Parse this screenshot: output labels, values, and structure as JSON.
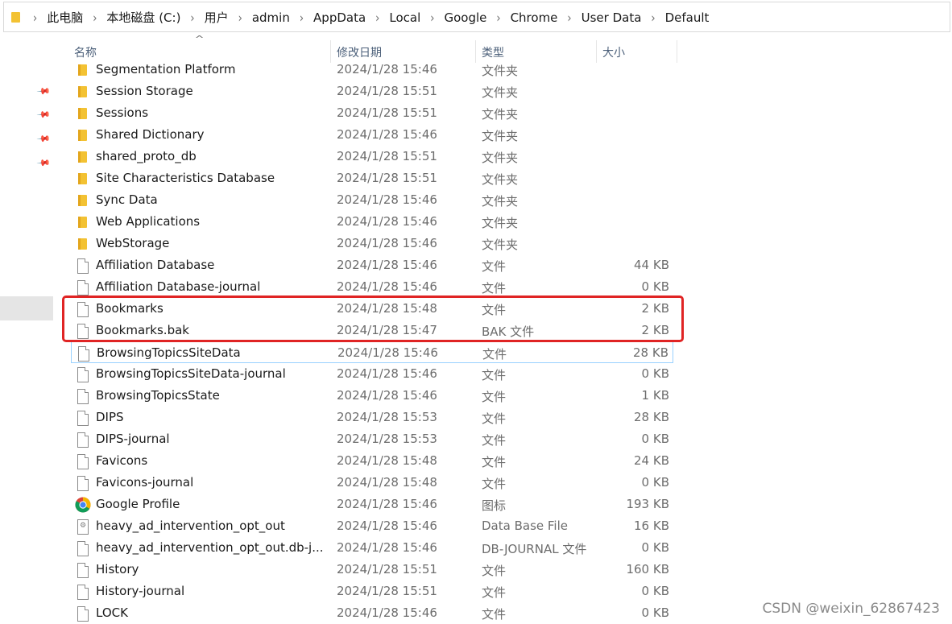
{
  "address_bar": {
    "crumbs": [
      "此电脑",
      "本地磁盘 (C:)",
      "用户",
      "admin",
      "AppData",
      "Local",
      "Google",
      "Chrome",
      "User Data",
      "Default"
    ]
  },
  "columns": {
    "name": "名称",
    "date": "修改日期",
    "type": "类型",
    "size": "大小"
  },
  "files": [
    {
      "icon": "folder-icon",
      "name": "Segmentation Platform",
      "date": "2024/1/28 15:46",
      "type": "文件夹",
      "size": ""
    },
    {
      "icon": "folder-icon",
      "name": "Session Storage",
      "date": "2024/1/28 15:51",
      "type": "文件夹",
      "size": ""
    },
    {
      "icon": "folder-icon",
      "name": "Sessions",
      "date": "2024/1/28 15:51",
      "type": "文件夹",
      "size": ""
    },
    {
      "icon": "folder-icon",
      "name": "Shared Dictionary",
      "date": "2024/1/28 15:46",
      "type": "文件夹",
      "size": ""
    },
    {
      "icon": "folder-icon",
      "name": "shared_proto_db",
      "date": "2024/1/28 15:51",
      "type": "文件夹",
      "size": ""
    },
    {
      "icon": "folder-icon",
      "name": "Site Characteristics Database",
      "date": "2024/1/28 15:51",
      "type": "文件夹",
      "size": ""
    },
    {
      "icon": "folder-icon",
      "name": "Sync Data",
      "date": "2024/1/28 15:46",
      "type": "文件夹",
      "size": ""
    },
    {
      "icon": "folder-icon",
      "name": "Web Applications",
      "date": "2024/1/28 15:46",
      "type": "文件夹",
      "size": ""
    },
    {
      "icon": "folder-icon",
      "name": "WebStorage",
      "date": "2024/1/28 15:46",
      "type": "文件夹",
      "size": ""
    },
    {
      "icon": "file-icon",
      "name": "Affiliation Database",
      "date": "2024/1/28 15:46",
      "type": "文件",
      "size": "44 KB"
    },
    {
      "icon": "file-icon",
      "name": "Affiliation Database-journal",
      "date": "2024/1/28 15:46",
      "type": "文件",
      "size": "0 KB"
    },
    {
      "icon": "file-icon",
      "name": "Bookmarks",
      "date": "2024/1/28 15:48",
      "type": "文件",
      "size": "2 KB"
    },
    {
      "icon": "file-icon",
      "name": "Bookmarks.bak",
      "date": "2024/1/28 15:47",
      "type": "BAK 文件",
      "size": "2 KB"
    },
    {
      "icon": "file-icon",
      "name": "BrowsingTopicsSiteData",
      "date": "2024/1/28 15:46",
      "type": "文件",
      "size": "28 KB"
    },
    {
      "icon": "file-icon",
      "name": "BrowsingTopicsSiteData-journal",
      "date": "2024/1/28 15:46",
      "type": "文件",
      "size": "0 KB"
    },
    {
      "icon": "file-icon",
      "name": "BrowsingTopicsState",
      "date": "2024/1/28 15:46",
      "type": "文件",
      "size": "1 KB"
    },
    {
      "icon": "file-icon",
      "name": "DIPS",
      "date": "2024/1/28 15:53",
      "type": "文件",
      "size": "28 KB"
    },
    {
      "icon": "file-icon",
      "name": "DIPS-journal",
      "date": "2024/1/28 15:53",
      "type": "文件",
      "size": "0 KB"
    },
    {
      "icon": "file-icon",
      "name": "Favicons",
      "date": "2024/1/28 15:48",
      "type": "文件",
      "size": "24 KB"
    },
    {
      "icon": "file-icon",
      "name": "Favicons-journal",
      "date": "2024/1/28 15:48",
      "type": "文件",
      "size": "0 KB"
    },
    {
      "icon": "chrome-icon",
      "name": "Google Profile",
      "date": "2024/1/28 15:46",
      "type": "图标",
      "size": "193 KB"
    },
    {
      "icon": "db-icon",
      "name": "heavy_ad_intervention_opt_out",
      "date": "2024/1/28 15:46",
      "type": "Data Base File",
      "size": "16 KB"
    },
    {
      "icon": "file-icon",
      "name": "heavy_ad_intervention_opt_out.db-j...",
      "date": "2024/1/28 15:46",
      "type": "DB-JOURNAL 文件",
      "size": "0 KB"
    },
    {
      "icon": "file-icon",
      "name": "History",
      "date": "2024/1/28 15:51",
      "type": "文件",
      "size": "160 KB"
    },
    {
      "icon": "file-icon",
      "name": "History-journal",
      "date": "2024/1/28 15:51",
      "type": "文件",
      "size": "0 KB"
    },
    {
      "icon": "file-icon",
      "name": "LOCK",
      "date": "2024/1/28 15:46",
      "type": "文件",
      "size": "0 KB"
    }
  ],
  "focused_row": "BrowsingTopicsSiteData",
  "highlighted_rows": [
    "Bookmarks",
    "Bookmarks.bak"
  ],
  "highlight_color": "#e02424",
  "folder_color": "#f3c233",
  "watermark": "CSDN @weixin_62867423"
}
